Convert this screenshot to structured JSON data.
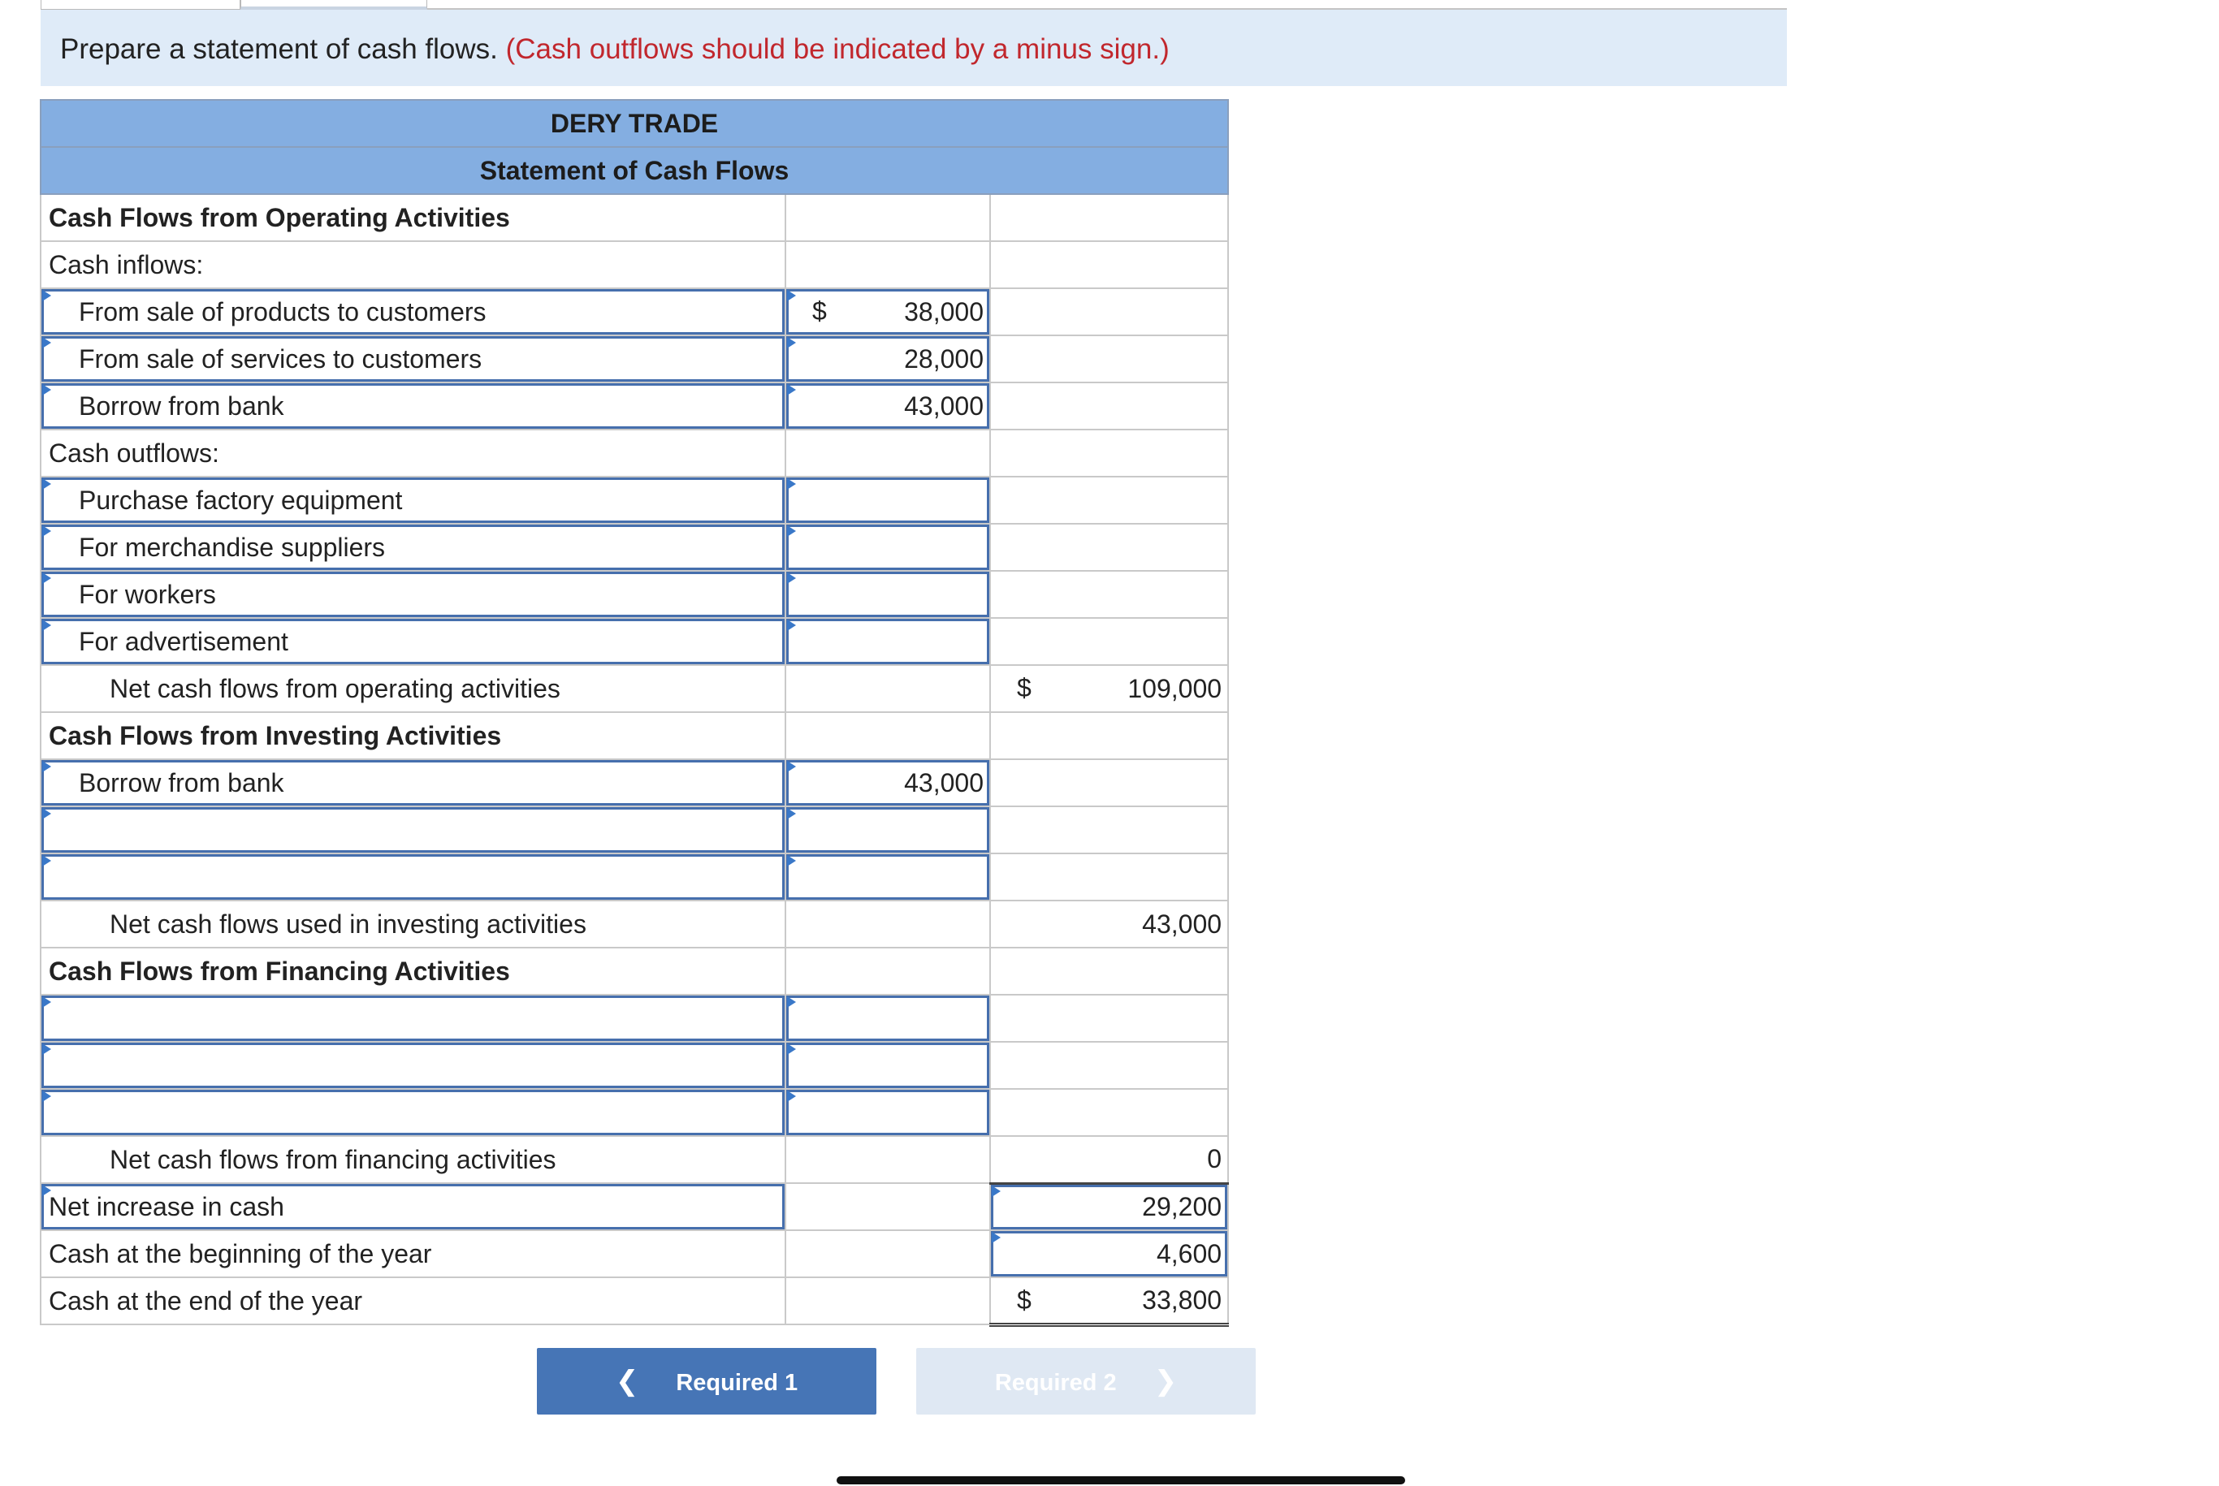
{
  "instruction": {
    "text": "Prepare a statement of cash flows.",
    "note": "(Cash outflows should be indicated by a minus sign.)"
  },
  "statement": {
    "company": "DERY TRADE",
    "title": "Statement of Cash Flows",
    "operating": {
      "header": "Cash Flows from Operating Activities",
      "inflows_label": "Cash inflows:",
      "inflows": [
        {
          "label": "From sale of products to customers",
          "currency": "$",
          "amount": "38,000"
        },
        {
          "label": "From sale of services to customers",
          "amount": "28,000"
        },
        {
          "label": "Borrow from bank",
          "amount": "43,000"
        }
      ],
      "outflows_label": "Cash outflows:",
      "outflows": [
        {
          "label": "Purchase factory equipment",
          "amount": ""
        },
        {
          "label": "For merchandise suppliers",
          "amount": ""
        },
        {
          "label": "For workers",
          "amount": ""
        },
        {
          "label": "For advertisement",
          "amount": ""
        }
      ],
      "net_label": "Net cash flows from operating activities",
      "net_currency": "$",
      "net_amount": "109,000"
    },
    "investing": {
      "header": "Cash Flows from Investing Activities",
      "rows": [
        {
          "label": "Borrow from bank",
          "amount": "43,000"
        },
        {
          "label": "",
          "amount": ""
        },
        {
          "label": "",
          "amount": ""
        }
      ],
      "net_label": "Net cash flows used in investing activities",
      "net_amount": "43,000"
    },
    "financing": {
      "header": "Cash Flows from Financing Activities",
      "rows": [
        {
          "label": "",
          "amount": ""
        },
        {
          "label": "",
          "amount": ""
        },
        {
          "label": "",
          "amount": ""
        }
      ],
      "net_label": "Net cash flows from financing activities",
      "net_amount": "0"
    },
    "net_increase": {
      "label": "Net increase in cash",
      "amount": "29,200"
    },
    "beginning": {
      "label": "Cash at the beginning of the year",
      "amount": "4,600"
    },
    "ending": {
      "label": "Cash at the end of the year",
      "currency": "$",
      "amount": "33,800"
    }
  },
  "nav": {
    "prev_label": "Required 1",
    "next_label": "Required 2",
    "prev_icon": "chevron-left-icon",
    "next_icon": "chevron-right-icon",
    "prev_color": "#4675b6",
    "next_color": "#dfe8f3"
  }
}
